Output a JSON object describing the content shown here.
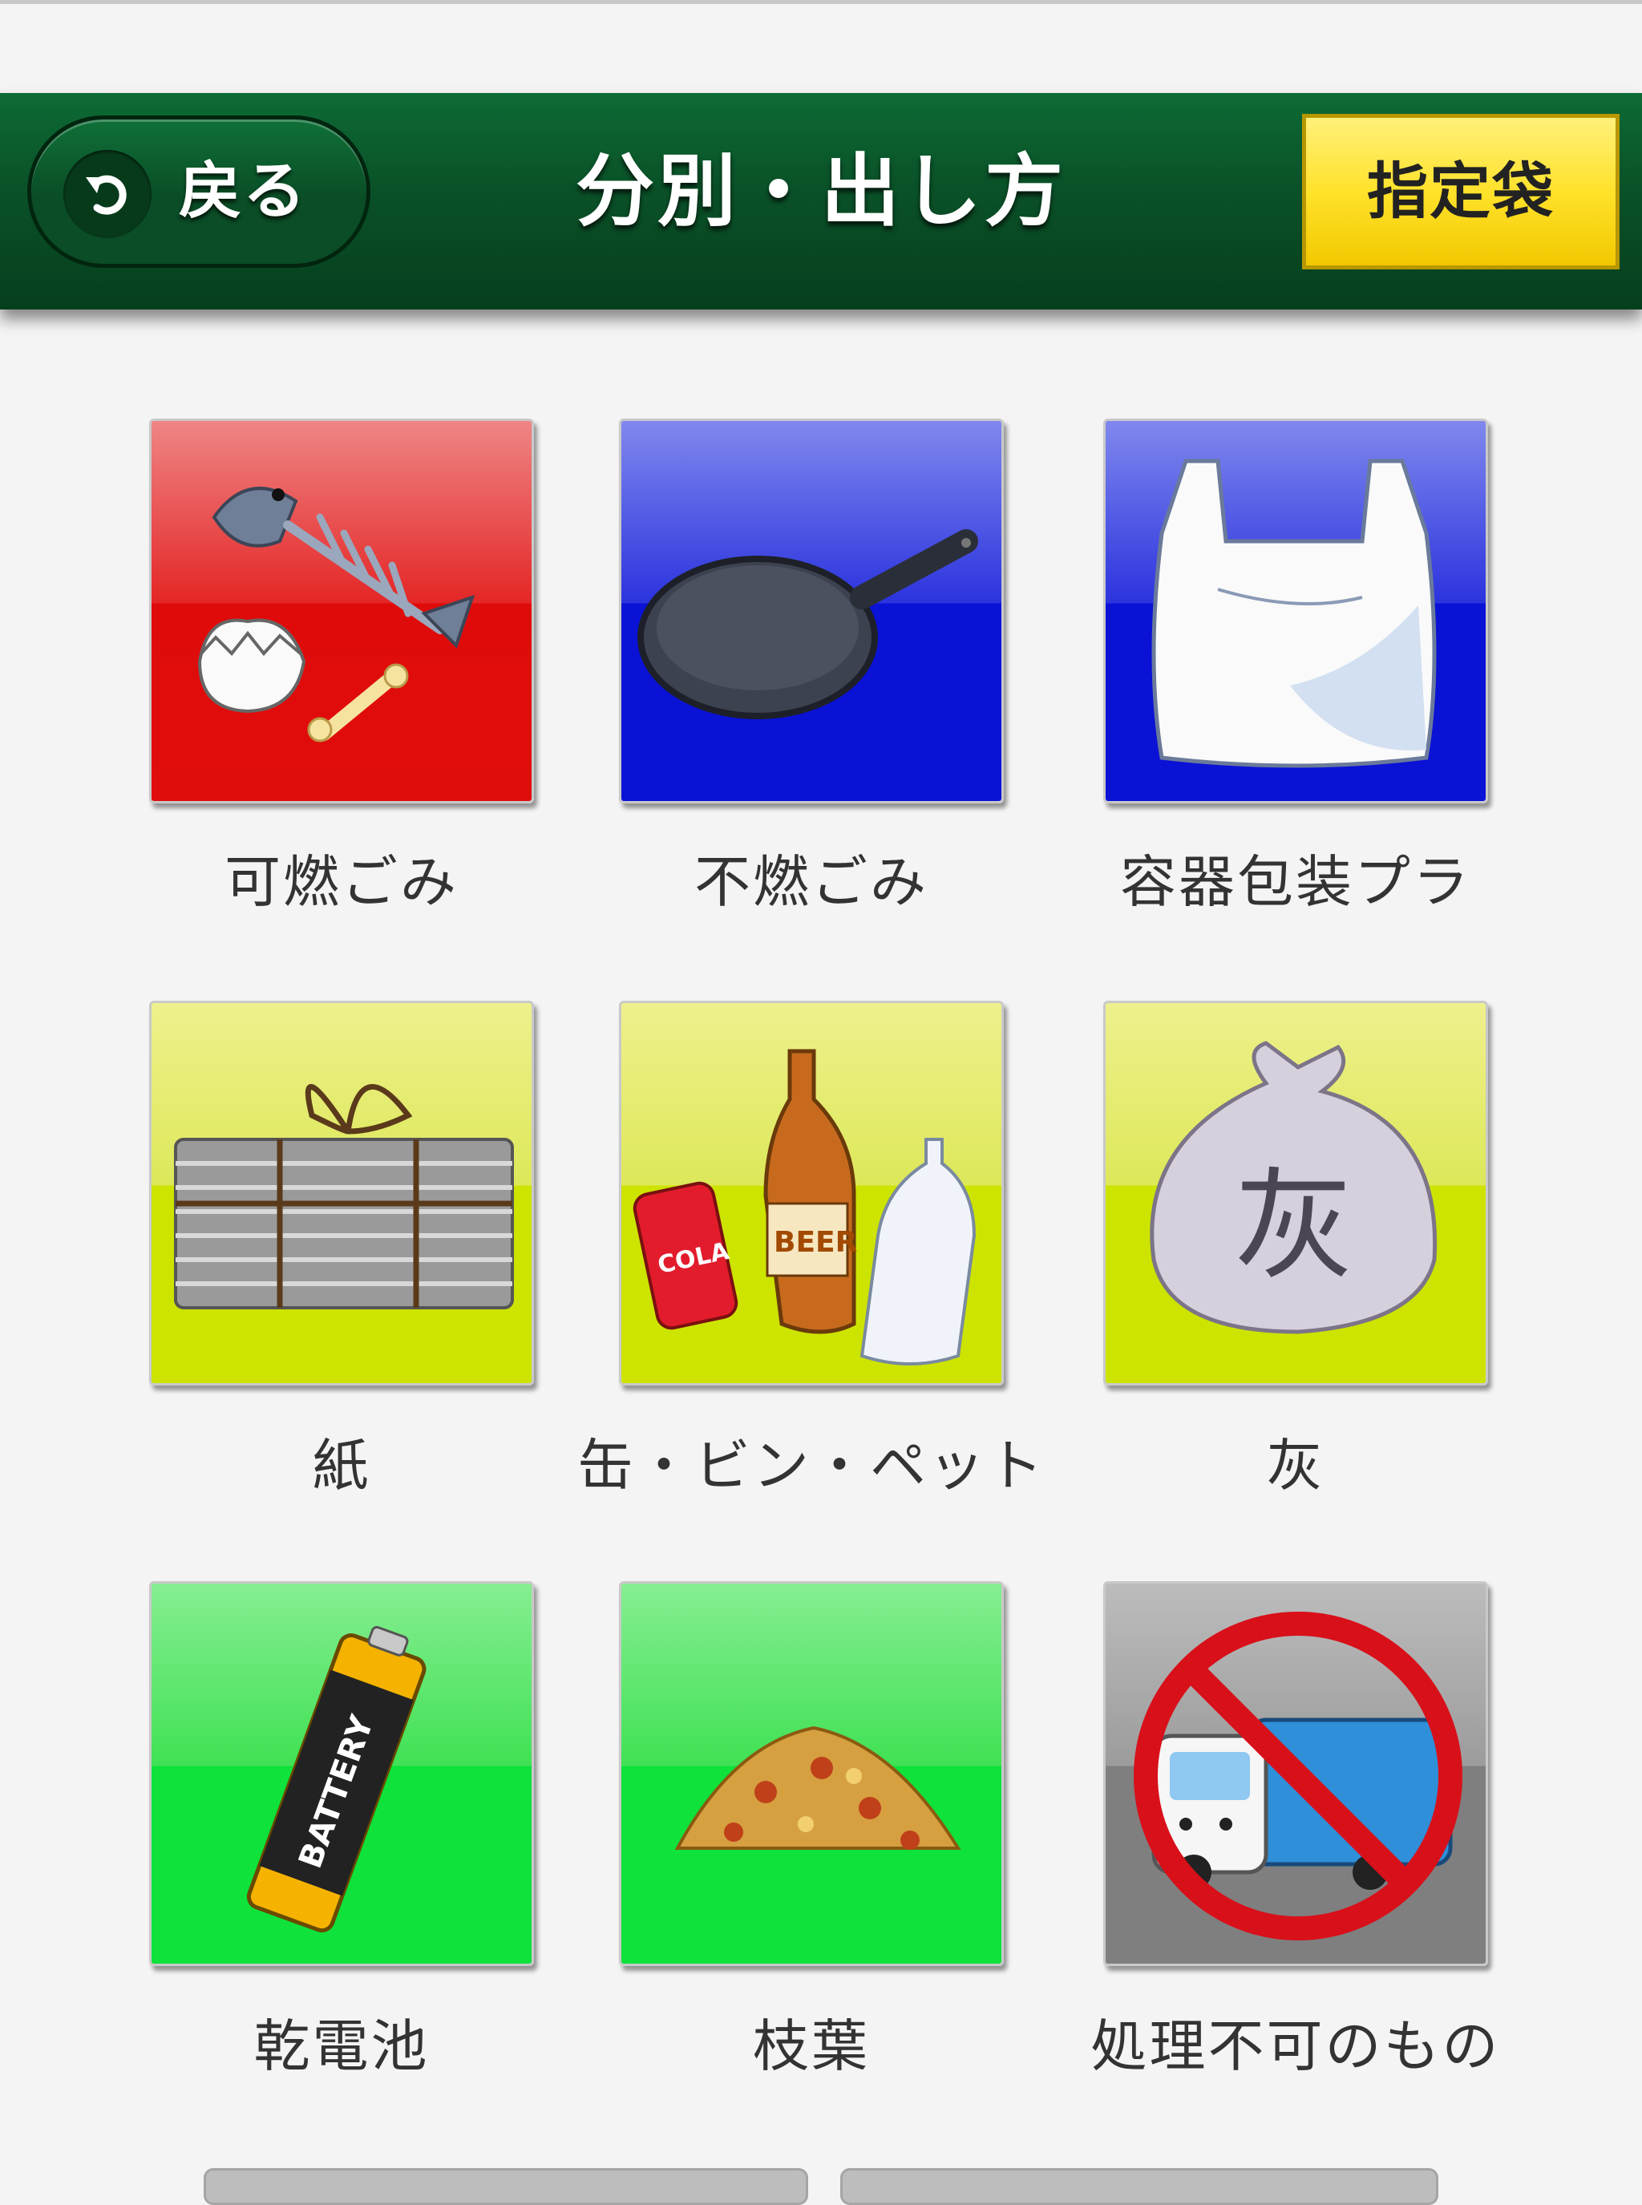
{
  "header": {
    "back_label": "戻る",
    "title": "分別・出し方",
    "bag_button_label": "指定袋"
  },
  "categories": [
    {
      "label": "可燃ごみ",
      "icon": "fish-bone-icon",
      "color": "#e00d0d"
    },
    {
      "label": "不燃ごみ",
      "icon": "frying-pan-icon",
      "color": "#0a12d6"
    },
    {
      "label": "容器包装プラ",
      "icon": "plastic-bag-icon",
      "color": "#0a12d6"
    },
    {
      "label": "紙",
      "icon": "newspaper-bundle-icon",
      "color": "#cde400"
    },
    {
      "label": "缶・ビン・ペット",
      "icon": "can-bottle-pet-icon",
      "color": "#cde400"
    },
    {
      "label": "灰",
      "icon": "ash-bag-icon",
      "color": "#cde400",
      "icon_text": "灰"
    },
    {
      "label": "乾電池",
      "icon": "battery-icon",
      "color": "#0ee23b",
      "icon_text": "BATTERY"
    },
    {
      "label": "枝葉",
      "icon": "leaf-pile-icon",
      "color": "#0ee23b"
    },
    {
      "label": "処理不可のもの",
      "icon": "no-garbage-truck-icon",
      "color": "#7f7f7f"
    }
  ],
  "icon_texts": {
    "cola": "COLA",
    "beer": "BEER"
  },
  "colors": {
    "header_green": "#0a5128",
    "bag_button_yellow": "#ffe22b"
  }
}
